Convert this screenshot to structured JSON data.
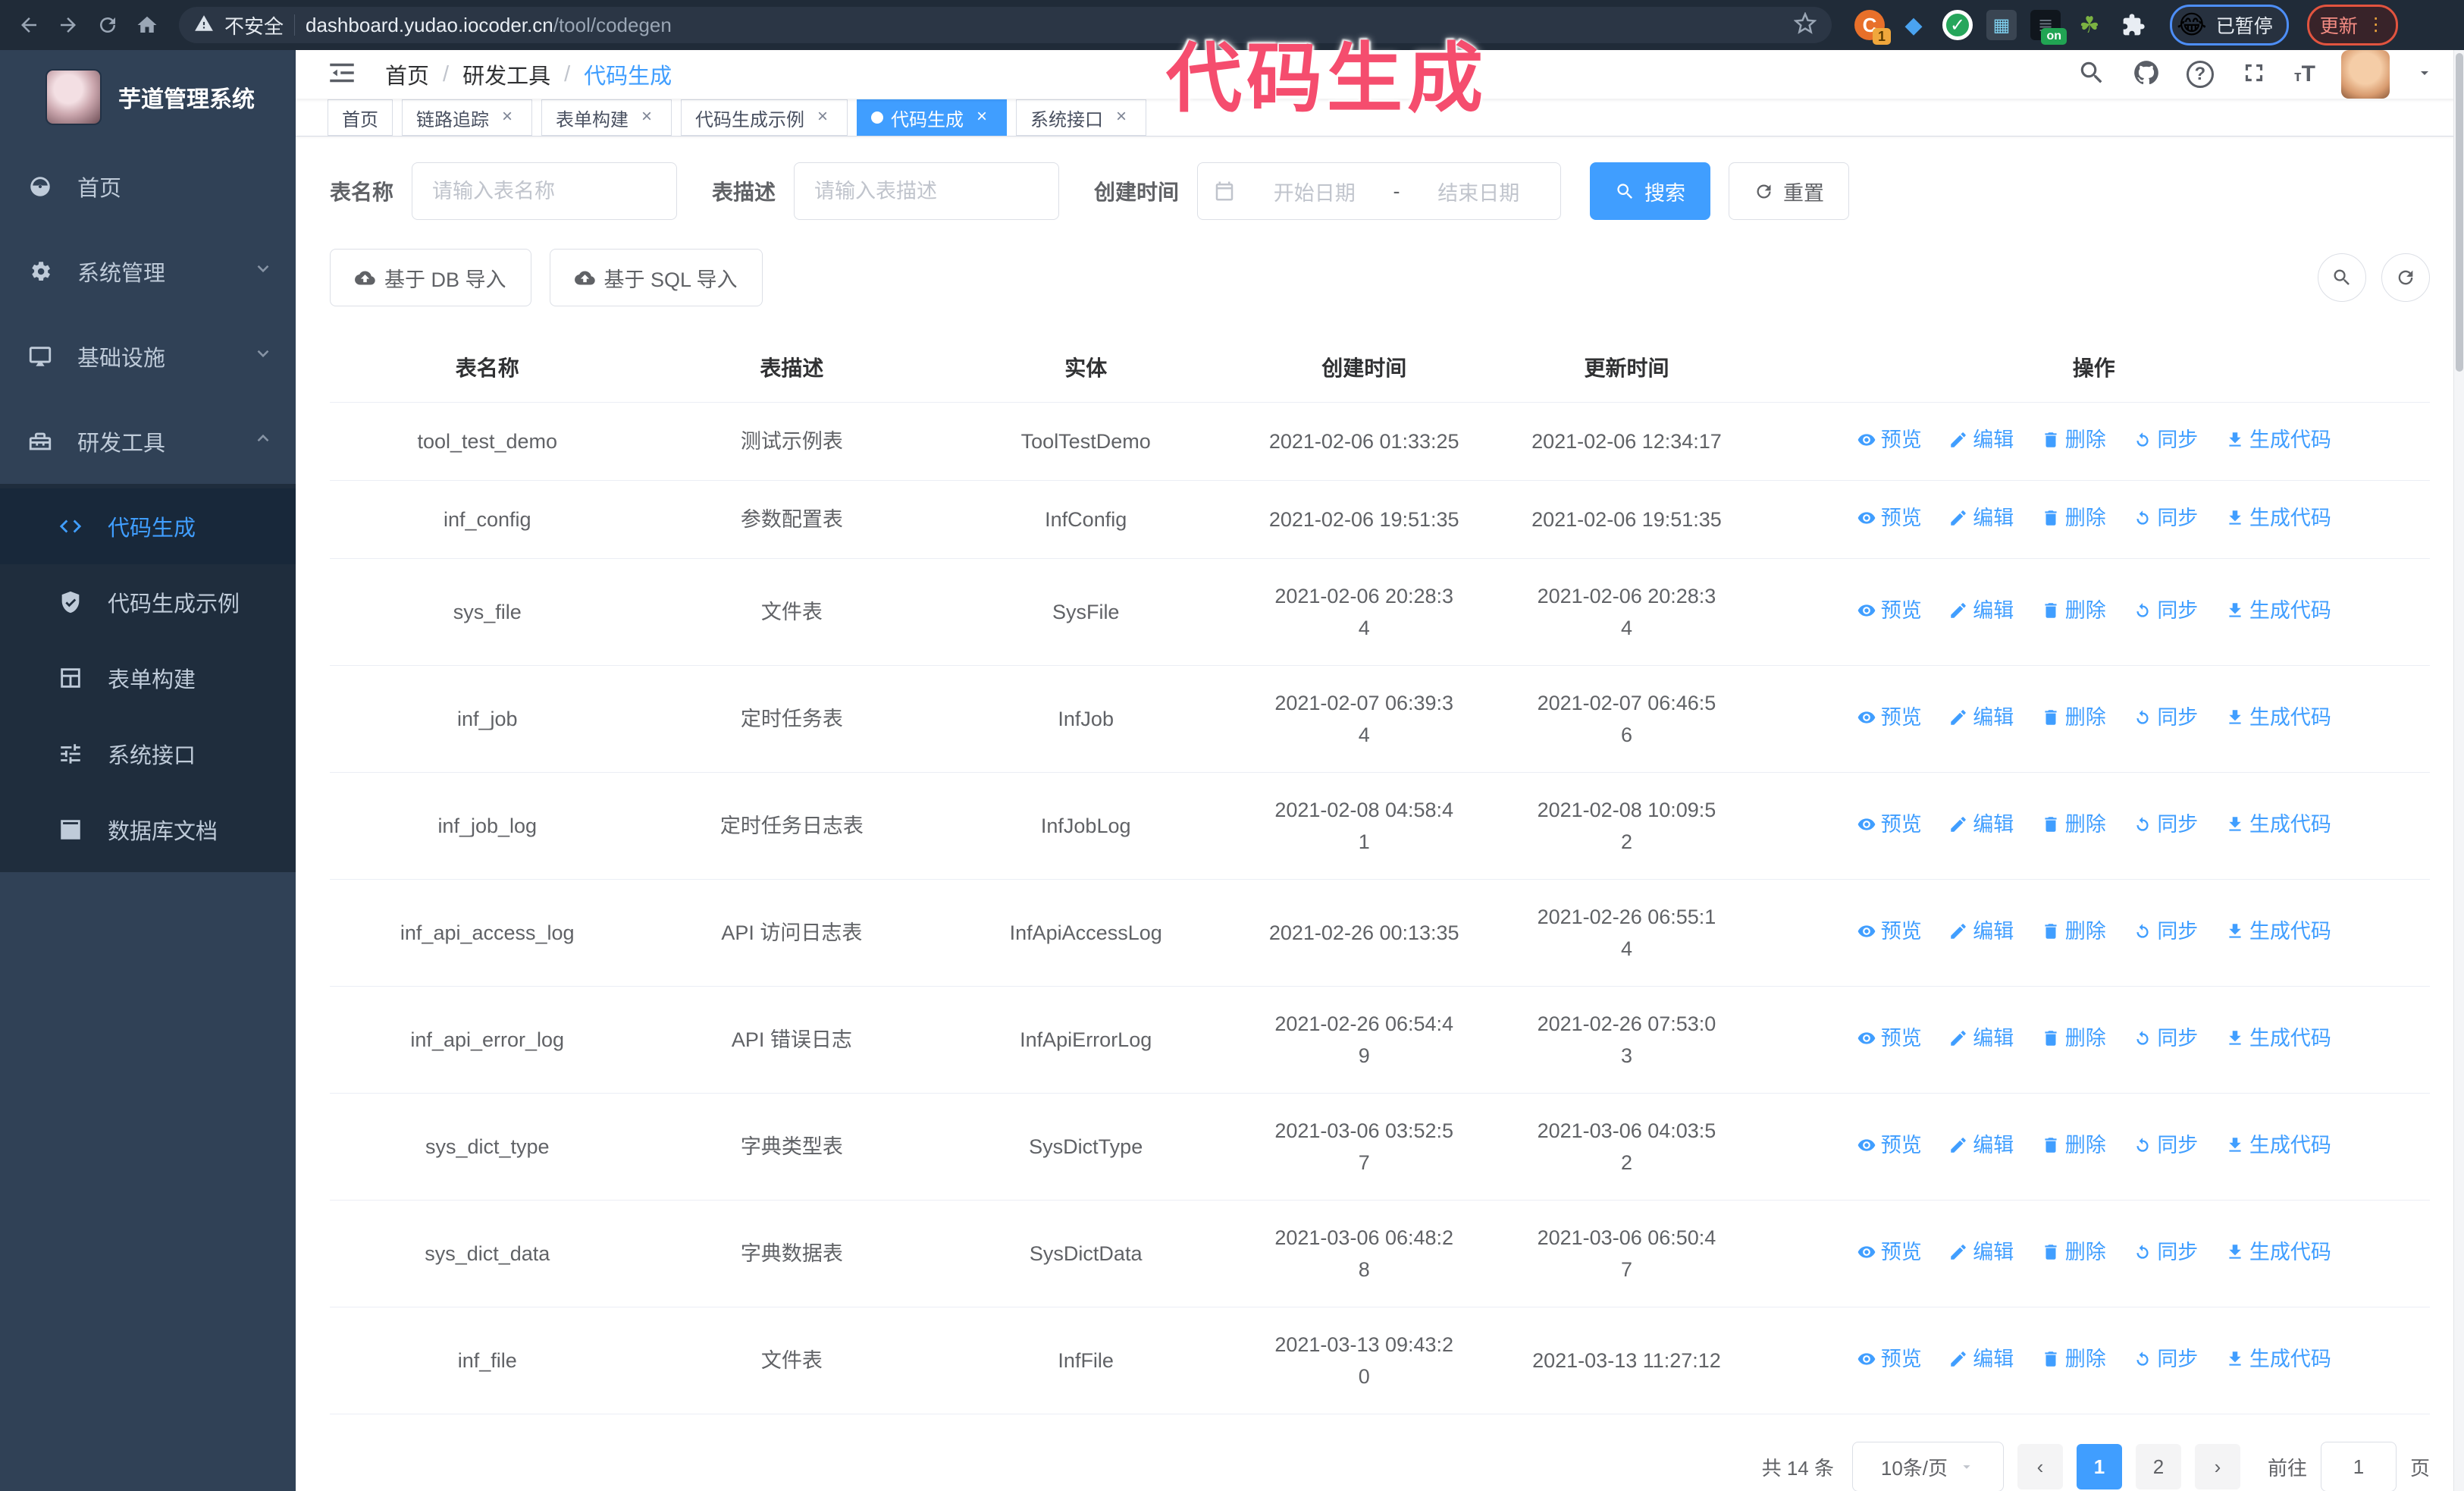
{
  "browser": {
    "security_label": "不安全",
    "url_host": "dashboard.yudao.iocoder.cn",
    "url_path": "/tool/codegen",
    "extension_badge": "1",
    "extension_on_badge": "on",
    "profile_emoji": "😂",
    "profile_status": "已暂停",
    "update_label": "更新",
    "update_menu_dots": "⋮"
  },
  "watermark": "代码生成",
  "sidebar": {
    "app_title": "芋道管理系统",
    "items": [
      {
        "label": "首页",
        "icon": "dashboard-icon"
      },
      {
        "label": "系统管理",
        "icon": "gear-icon",
        "state": "collapsed"
      },
      {
        "label": "基础设施",
        "icon": "monitor-icon",
        "state": "collapsed"
      },
      {
        "label": "研发工具",
        "icon": "toolbox-icon",
        "state": "expanded"
      }
    ],
    "submenu": [
      {
        "label": "代码生成",
        "icon": "code-icon",
        "active": true
      },
      {
        "label": "代码生成示例",
        "icon": "shield-check-icon"
      },
      {
        "label": "表单构建",
        "icon": "form-icon"
      },
      {
        "label": "系统接口",
        "icon": "sliders-icon"
      },
      {
        "label": "数据库文档",
        "icon": "database-icon"
      }
    ]
  },
  "navbar": {
    "breadcrumb": [
      "首页",
      "研发工具",
      "代码生成"
    ],
    "separator": "/"
  },
  "tags": [
    {
      "label": "首页",
      "closable": false,
      "active": false
    },
    {
      "label": "链路追踪",
      "closable": true,
      "active": false
    },
    {
      "label": "表单构建",
      "closable": true,
      "active": false
    },
    {
      "label": "代码生成示例",
      "closable": true,
      "active": false
    },
    {
      "label": "代码生成",
      "closable": true,
      "active": true
    },
    {
      "label": "系统接口",
      "closable": true,
      "active": false
    }
  ],
  "search": {
    "name_label": "表名称",
    "name_placeholder": "请输入表名称",
    "desc_label": "表描述",
    "desc_placeholder": "请输入表描述",
    "time_label": "创建时间",
    "start_placeholder": "开始日期",
    "range_separator": "-",
    "end_placeholder": "结束日期",
    "search_label": "搜索",
    "reset_label": "重置"
  },
  "toolbar": {
    "import_db_label": "基于 DB 导入",
    "import_sql_label": "基于 SQL 导入"
  },
  "table": {
    "columns": [
      "表名称",
      "表描述",
      "实体",
      "创建时间",
      "更新时间",
      "操作"
    ],
    "actions": [
      {
        "label": "预览",
        "icon": "eye-icon"
      },
      {
        "label": "编辑",
        "icon": "pencil-icon"
      },
      {
        "label": "删除",
        "icon": "trash-icon"
      },
      {
        "label": "同步",
        "icon": "sync-icon"
      },
      {
        "label": "生成代码",
        "icon": "download-icon"
      }
    ],
    "rows": [
      {
        "name": "tool_test_demo",
        "desc": "测试示例表",
        "entity": "ToolTestDemo",
        "created": "2021-02-06 01:33:25",
        "updated": "2021-02-06 12:34:17"
      },
      {
        "name": "inf_config",
        "desc": "参数配置表",
        "entity": "InfConfig",
        "created": "2021-02-06 19:51:35",
        "updated": "2021-02-06 19:51:35"
      },
      {
        "name": "sys_file",
        "desc": "文件表",
        "entity": "SysFile",
        "created": "2021-02-06 20:28:3\n4",
        "updated": "2021-02-06 20:28:3\n4"
      },
      {
        "name": "inf_job",
        "desc": "定时任务表",
        "entity": "InfJob",
        "created": "2021-02-07 06:39:3\n4",
        "updated": "2021-02-07 06:46:5\n6"
      },
      {
        "name": "inf_job_log",
        "desc": "定时任务日志表",
        "entity": "InfJobLog",
        "created": "2021-02-08 04:58:4\n1",
        "updated": "2021-02-08 10:09:5\n2"
      },
      {
        "name": "inf_api_access_log",
        "desc": "API 访问日志表",
        "entity": "InfApiAccessLog",
        "created": "2021-02-26 00:13:35",
        "updated": "2021-02-26 06:55:1\n4"
      },
      {
        "name": "inf_api_error_log",
        "desc": "API 错误日志",
        "entity": "InfApiErrorLog",
        "created": "2021-02-26 06:54:4\n9",
        "updated": "2021-02-26 07:53:0\n3"
      },
      {
        "name": "sys_dict_type",
        "desc": "字典类型表",
        "entity": "SysDictType",
        "created": "2021-03-06 03:52:5\n7",
        "updated": "2021-03-06 04:03:5\n2"
      },
      {
        "name": "sys_dict_data",
        "desc": "字典数据表",
        "entity": "SysDictData",
        "created": "2021-03-06 06:48:2\n8",
        "updated": "2021-03-06 06:50:4\n7"
      },
      {
        "name": "inf_file",
        "desc": "文件表",
        "entity": "InfFile",
        "created": "2021-03-13 09:43:2\n0",
        "updated": "2021-03-13 11:27:12"
      }
    ]
  },
  "pagination": {
    "total": "共 14 条",
    "page_size": "10条/页",
    "pages": [
      "1",
      "2"
    ],
    "current": "1",
    "goto_label": "前往",
    "goto_value": "1",
    "page_label": "页"
  },
  "colors": {
    "primary": "#409EFF",
    "sidebar_bg": "#304156",
    "submenu_bg": "#1f2d3d",
    "chrome_bg": "#202b38",
    "watermark_pink": "#f54d6e"
  }
}
